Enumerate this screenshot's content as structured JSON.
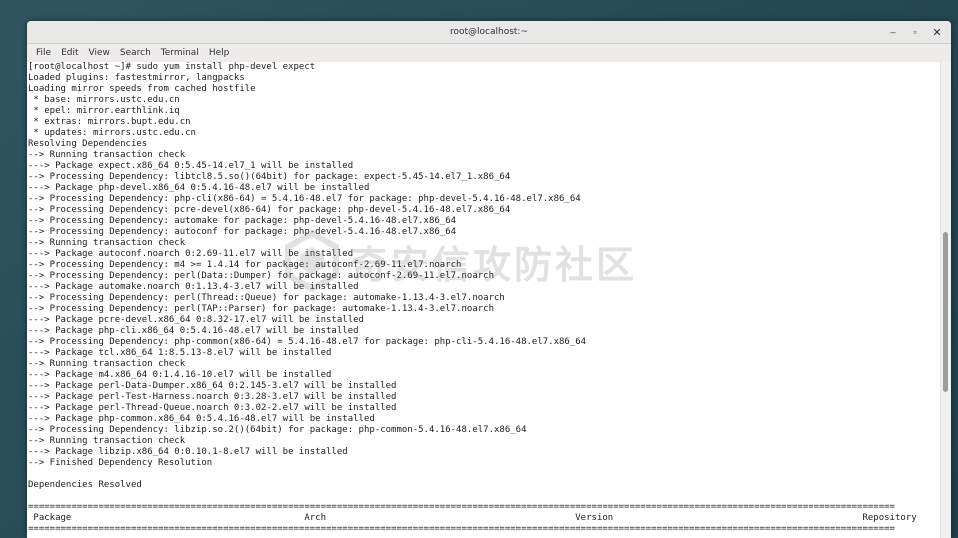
{
  "window": {
    "title": "root@localhost:~",
    "controls": {
      "minimize": "–",
      "maximize": "▫",
      "close": "✕"
    }
  },
  "menu": [
    "File",
    "Edit",
    "View",
    "Search",
    "Terminal",
    "Help"
  ],
  "terminal_lines": [
    "[root@localhost ~]# sudo yum install php-devel expect",
    "Loaded plugins: fastestmirror, langpacks",
    "Loading mirror speeds from cached hostfile",
    " * base: mirrors.ustc.edu.cn",
    " * epel: mirror.earthlink.iq",
    " * extras: mirrors.bupt.edu.cn",
    " * updates: mirrors.ustc.edu.cn",
    "Resolving Dependencies",
    "--> Running transaction check",
    "---> Package expect.x86_64 0:5.45-14.el7_1 will be installed",
    "--> Processing Dependency: libtcl8.5.so()(64bit) for package: expect-5.45-14.el7_1.x86_64",
    "---> Package php-devel.x86_64 0:5.4.16-48.el7 will be installed",
    "--> Processing Dependency: php-cli(x86-64) = 5.4.16-48.el7 for package: php-devel-5.4.16-48.el7.x86_64",
    "--> Processing Dependency: pcre-devel(x86-64) for package: php-devel-5.4.16-48.el7.x86_64",
    "--> Processing Dependency: automake for package: php-devel-5.4.16-48.el7.x86_64",
    "--> Processing Dependency: autoconf for package: php-devel-5.4.16-48.el7.x86_64",
    "--> Running transaction check",
    "---> Package autoconf.noarch 0:2.69-11.el7 will be installed",
    "--> Processing Dependency: m4 >= 1.4.14 for package: autoconf-2.69-11.el7.noarch",
    "--> Processing Dependency: perl(Data::Dumper) for package: autoconf-2.69-11.el7.noarch",
    "---> Package automake.noarch 0:1.13.4-3.el7 will be installed",
    "--> Processing Dependency: perl(Thread::Queue) for package: automake-1.13.4-3.el7.noarch",
    "--> Processing Dependency: perl(TAP::Parser) for package: automake-1.13.4-3.el7.noarch",
    "---> Package pcre-devel.x86_64 0:8.32-17.el7 will be installed",
    "---> Package php-cli.x86_64 0:5.4.16-48.el7 will be installed",
    "--> Processing Dependency: php-common(x86-64) = 5.4.16-48.el7 for package: php-cli-5.4.16-48.el7.x86_64",
    "---> Package tcl.x86_64 1:8.5.13-8.el7 will be installed",
    "--> Running transaction check",
    "---> Package m4.x86_64 0:1.4.16-10.el7 will be installed",
    "---> Package perl-Data-Dumper.x86_64 0:2.145-3.el7 will be installed",
    "---> Package perl-Test-Harness.noarch 0:3.28-3.el7 will be installed",
    "---> Package perl-Thread-Queue.noarch 0:3.02-2.el7 will be installed",
    "---> Package php-common.x86_64 0:5.4.16-48.el7 will be installed",
    "--> Processing Dependency: libzip.so.2()(64bit) for package: php-common-5.4.16-48.el7.x86_64",
    "--> Running transaction check",
    "---> Package libzip.x86_64 0:0.10.1-8.el7 will be installed",
    "--> Finished Dependency Resolution",
    "",
    "Dependencies Resolved",
    "",
    "================================================================================================================================================================",
    " Package                                           Arch                                              Version                                              Repository                                  Size",
    "================================================================================================================================================================"
  ],
  "watermark": {
    "text": "奇安信攻防社区"
  },
  "colors": {
    "desktop": "#2a4b55",
    "terminal_bg": "#ffffff",
    "terminal_fg": "#1c1c1c"
  }
}
